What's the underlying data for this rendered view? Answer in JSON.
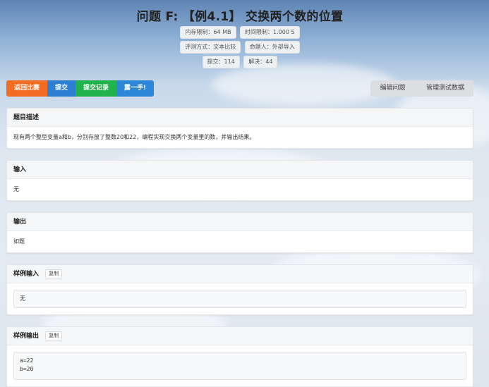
{
  "problem": {
    "title": "问题 F: 【例4.1】 交换两个数的位置",
    "badges_row1": [
      "内存限制：64 MB",
      "时间限制：1.000 S"
    ],
    "badges_row2": [
      "评测方式：文本比较",
      "命题人：外部导入"
    ],
    "badges_row3": [
      "提交：114",
      "解决：44"
    ]
  },
  "actions": {
    "back": "返回比赛",
    "submit": "提交",
    "records": "提交记录",
    "discuss": "露一手!",
    "edit": "编辑问题",
    "manage_tests": "管理测试数据"
  },
  "sections": {
    "description_title": "题目描述",
    "description_text": "现有两个整型变量a和b，分别存放了整数20和22，编程实现交换两个变量里的数，并输出结果。",
    "input_title": "输入",
    "input_text": "无",
    "output_title": "输出",
    "output_text": "如题",
    "sample_input_title": "样例输入",
    "sample_input_copy": "复制",
    "sample_input": "无",
    "sample_output_title": "样例输出",
    "sample_output_copy": "复制",
    "sample_output": "a=22\nb=20"
  }
}
